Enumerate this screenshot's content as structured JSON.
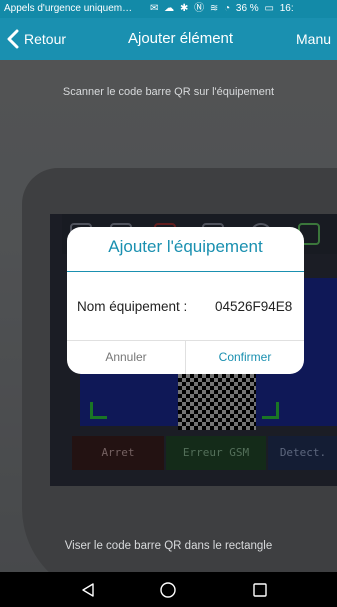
{
  "status_bar": {
    "notification": "Appels d'urgence uniquem…",
    "battery": "36 %",
    "time": "16:",
    "icons": [
      "mail-icon",
      "cloud-icon",
      "bluetooth-icon",
      "nfc-icon",
      "vibrate-icon",
      "wifi-icon",
      "battery-icon"
    ]
  },
  "title_bar": {
    "back_label": "Retour",
    "title": "Ajouter élément",
    "right_label": "Manu",
    "color": "#1a90b0"
  },
  "scanner": {
    "top_hint": "Scanner le code barre QR sur l'équipement",
    "bottom_hint": "Viser le code barre QR dans le rectangle",
    "device_buttons": [
      "Arret",
      "Erreur GSM",
      "Detect."
    ]
  },
  "dialog": {
    "title": "Ajouter l'équipement",
    "field_label": "Nom équipement :",
    "field_value": "04526F94E8",
    "cancel_label": "Annuler",
    "confirm_label": "Confirmer"
  },
  "nav_bar": {
    "icons": [
      "back-triangle-icon",
      "home-circle-icon",
      "recents-square-icon"
    ]
  }
}
